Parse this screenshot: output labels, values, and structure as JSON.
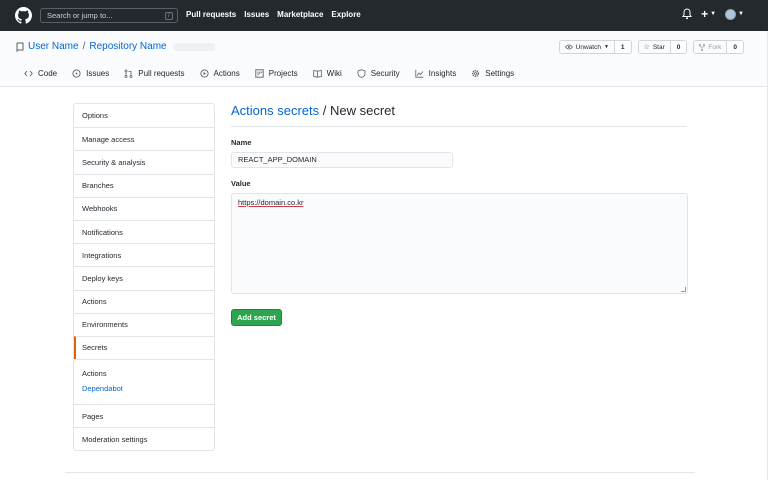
{
  "header": {
    "search_placeholder": "Search or jump to...",
    "search_key": "/",
    "nav": [
      "Pull requests",
      "Issues",
      "Marketplace",
      "Explore"
    ],
    "plus": "+"
  },
  "repo": {
    "owner": "User Name",
    "separator": "/",
    "name": "Repository Name",
    "unwatch_label": "Unwatch",
    "unwatch_count": "1",
    "star_label": "Star",
    "star_count": "0",
    "fork_label": "Fork",
    "fork_count": "0"
  },
  "tabs": [
    {
      "label": "Code",
      "icon": "code-icon"
    },
    {
      "label": "Issues",
      "icon": "issue-icon"
    },
    {
      "label": "Pull requests",
      "icon": "pull-request-icon"
    },
    {
      "label": "Actions",
      "icon": "play-icon"
    },
    {
      "label": "Projects",
      "icon": "project-icon"
    },
    {
      "label": "Wiki",
      "icon": "book-icon"
    },
    {
      "label": "Security",
      "icon": "shield-icon"
    },
    {
      "label": "Insights",
      "icon": "graph-icon"
    },
    {
      "label": "Settings",
      "icon": "gear-icon"
    }
  ],
  "sidebar": {
    "items": [
      "Options",
      "Manage access",
      "Security & analysis",
      "Branches",
      "Webhooks",
      "Notifications",
      "Integrations",
      "Deploy keys",
      "Actions",
      "Environments",
      "Secrets"
    ],
    "sub_items": [
      "Actions",
      "Dependabot"
    ],
    "items_after": [
      "Pages",
      "Moderation settings"
    ]
  },
  "main": {
    "title_link": "Actions secrets",
    "title_rest": " / New secret",
    "name_label": "Name",
    "name_value": "REACT_APP_DOMAIN",
    "value_label": "Value",
    "value_text": "https://domain.co.kr",
    "submit_label": "Add secret"
  },
  "colors": {
    "header_bg": "#24292e",
    "link": "#0366d6",
    "primary_button": "#2ea44f",
    "selected_marker": "#e36209"
  }
}
